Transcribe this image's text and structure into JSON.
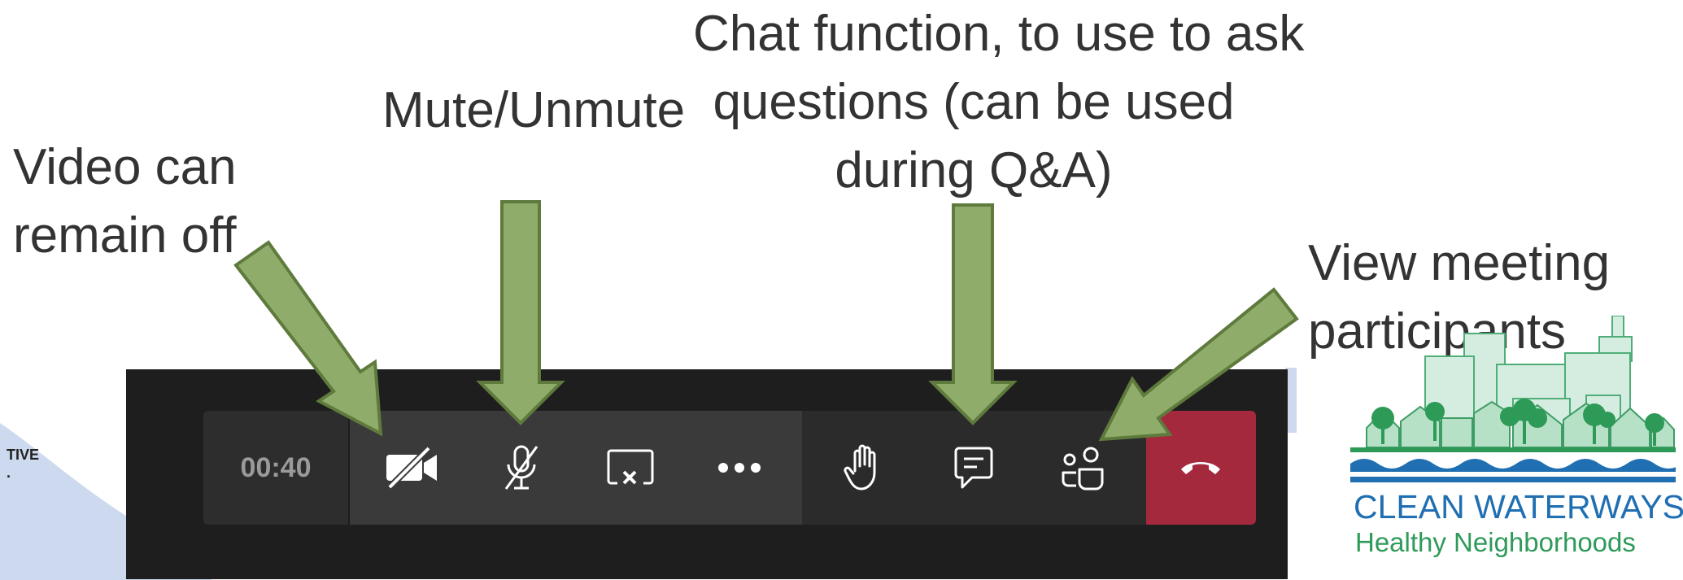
{
  "annotations": {
    "video": [
      "Video can",
      "remain off"
    ],
    "mute": [
      "Mute/Unmute"
    ],
    "chat": [
      "Chat function, to use to ask",
      "questions (can be used",
      "during Q&A)"
    ],
    "participants": [
      "View meeting",
      "participants"
    ]
  },
  "toolbar": {
    "timer": "00:40",
    "buttons": [
      {
        "name": "camera-toggle",
        "icon": "camera-off-icon",
        "state": "off"
      },
      {
        "name": "mic-toggle",
        "icon": "mic-off-icon",
        "state": "muted"
      },
      {
        "name": "share-screen",
        "icon": "stop-share-icon"
      },
      {
        "name": "more-actions",
        "icon": "more-icon"
      },
      {
        "name": "raise-hand",
        "icon": "hand-icon"
      },
      {
        "name": "chat",
        "icon": "chat-icon"
      },
      {
        "name": "participants",
        "icon": "participants-icon"
      },
      {
        "name": "leave-call",
        "icon": "hang-up-icon"
      }
    ],
    "colors": {
      "hangup": "#a4293d",
      "bar": "#1e1e1e",
      "arrow_fill": "#8fac6a",
      "arrow_stroke": "#5e7a3c"
    }
  },
  "edge_text": [
    "TIVE",
    "."
  ],
  "logo": {
    "title": "CLEAN WATERWAYS",
    "subtitle": "Healthy Neighborhoods",
    "colors": {
      "title": "#1f6fb2",
      "subtitle": "#2f9a5a"
    }
  }
}
